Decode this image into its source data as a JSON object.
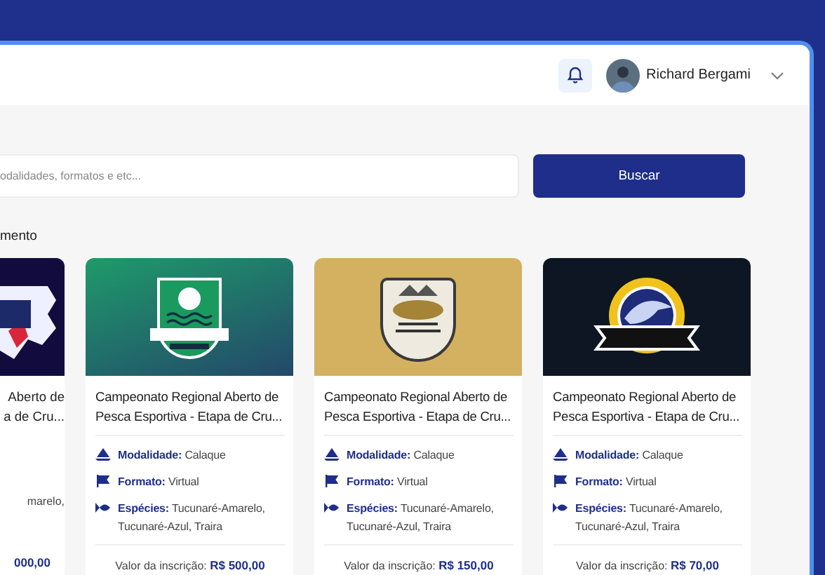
{
  "header": {
    "user_name": "Richard Bergami"
  },
  "search": {
    "placeholder": "odalidades, formatos e etc...",
    "button": "Buscar"
  },
  "section_title": "mento",
  "cards": [
    {
      "kind": "clipped",
      "title_lines": [
        "Aberto de",
        "a de Cru..."
      ],
      "species": "marelo,",
      "price": "000,00"
    },
    {
      "kind": "full",
      "title": "Campeonato Regional Aberto de Pesca Esportiva - Etapa de Cru...",
      "details": [
        {
          "kind": "boat",
          "label": "Modalidade:",
          "value": "Calaque"
        },
        {
          "kind": "flag",
          "label": "Formato:",
          "value": "Virtual"
        },
        {
          "kind": "fish",
          "label": "Espécies:",
          "value": "Tucunaré-Amarelo, Tucunaré-Azul, Traira"
        }
      ],
      "price_label": "Valor da inscrição:",
      "price": "R$ 500,00"
    },
    {
      "kind": "full",
      "title": "Campeonato Regional Aberto de Pesca Esportiva - Etapa de Cru...",
      "details": [
        {
          "kind": "boat",
          "label": "Modalidade:",
          "value": "Calaque"
        },
        {
          "kind": "flag",
          "label": "Formato:",
          "value": "Virtual"
        },
        {
          "kind": "fish",
          "label": "Espécies:",
          "value": "Tucunaré-Amarelo, Tucunaré-Azul, Traira"
        }
      ],
      "price_label": "Valor da inscrição:",
      "price": "R$ 150,00"
    },
    {
      "kind": "full",
      "title": "Campeonato Regional Aberto de Pesca Esportiva - Etapa de Cru...",
      "details": [
        {
          "kind": "boat",
          "label": "Modalidade:",
          "value": "Calaque"
        },
        {
          "kind": "flag",
          "label": "Formato:",
          "value": "Virtual"
        },
        {
          "kind": "fish",
          "label": "Espécies:",
          "value": "Tucunaré-Amarelo, Tucunaré-Azul, Traira"
        }
      ],
      "price_label": "Valor da inscrição:",
      "price": "R$ 70,00"
    }
  ]
}
